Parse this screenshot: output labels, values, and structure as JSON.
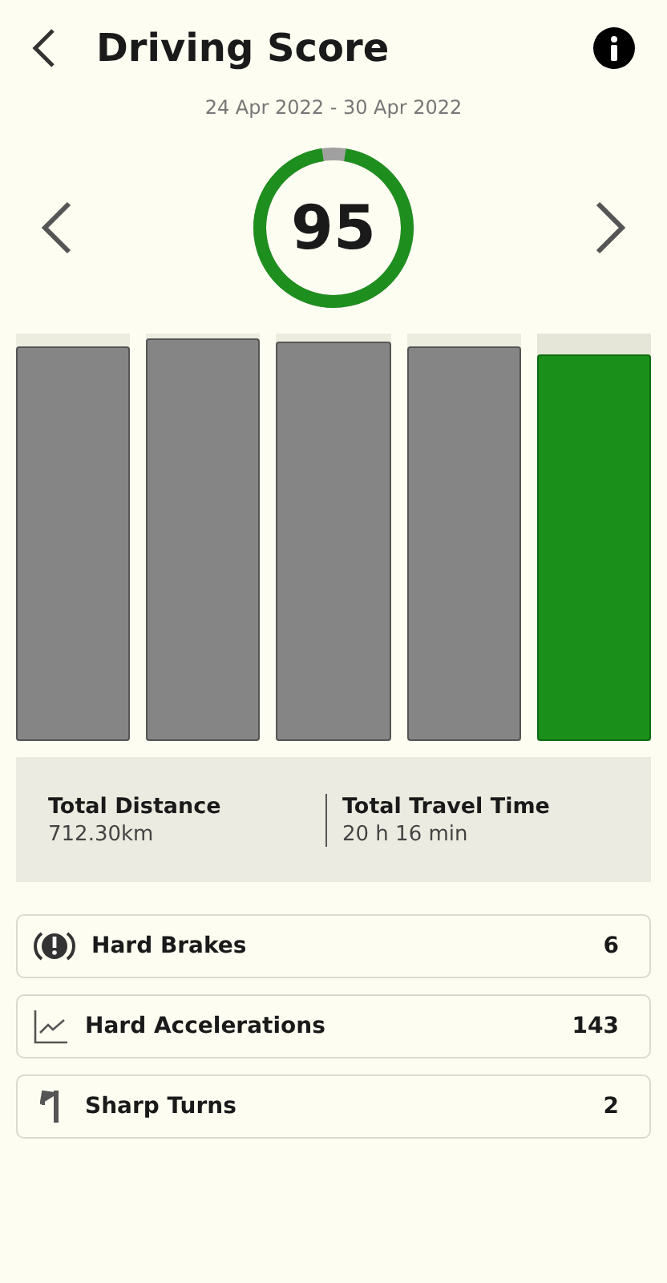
{
  "header": {
    "title": "Driving Score"
  },
  "period": {
    "date_range": "24 Apr 2022 - 30 Apr 2022"
  },
  "score": {
    "value": "95",
    "level": 0.95
  },
  "weeks": [
    {
      "level": 0.97,
      "selected": false
    },
    {
      "level": 0.99,
      "selected": false
    },
    {
      "level": 0.98,
      "selected": false
    },
    {
      "level": 0.97,
      "selected": false
    },
    {
      "level": 0.95,
      "selected": true
    }
  ],
  "summary": [
    {
      "label": "Total Distance",
      "value": "712.30km"
    },
    {
      "label": "Total Travel Time",
      "value": "20 h 16 min"
    }
  ],
  "events": [
    {
      "kind": "brake",
      "label": "Hard Brakes",
      "count": "6"
    },
    {
      "kind": "acceleration",
      "label": "Hard Accelerations",
      "count": "143"
    },
    {
      "kind": "turn",
      "label": "Sharp Turns",
      "count": "2"
    }
  ]
}
